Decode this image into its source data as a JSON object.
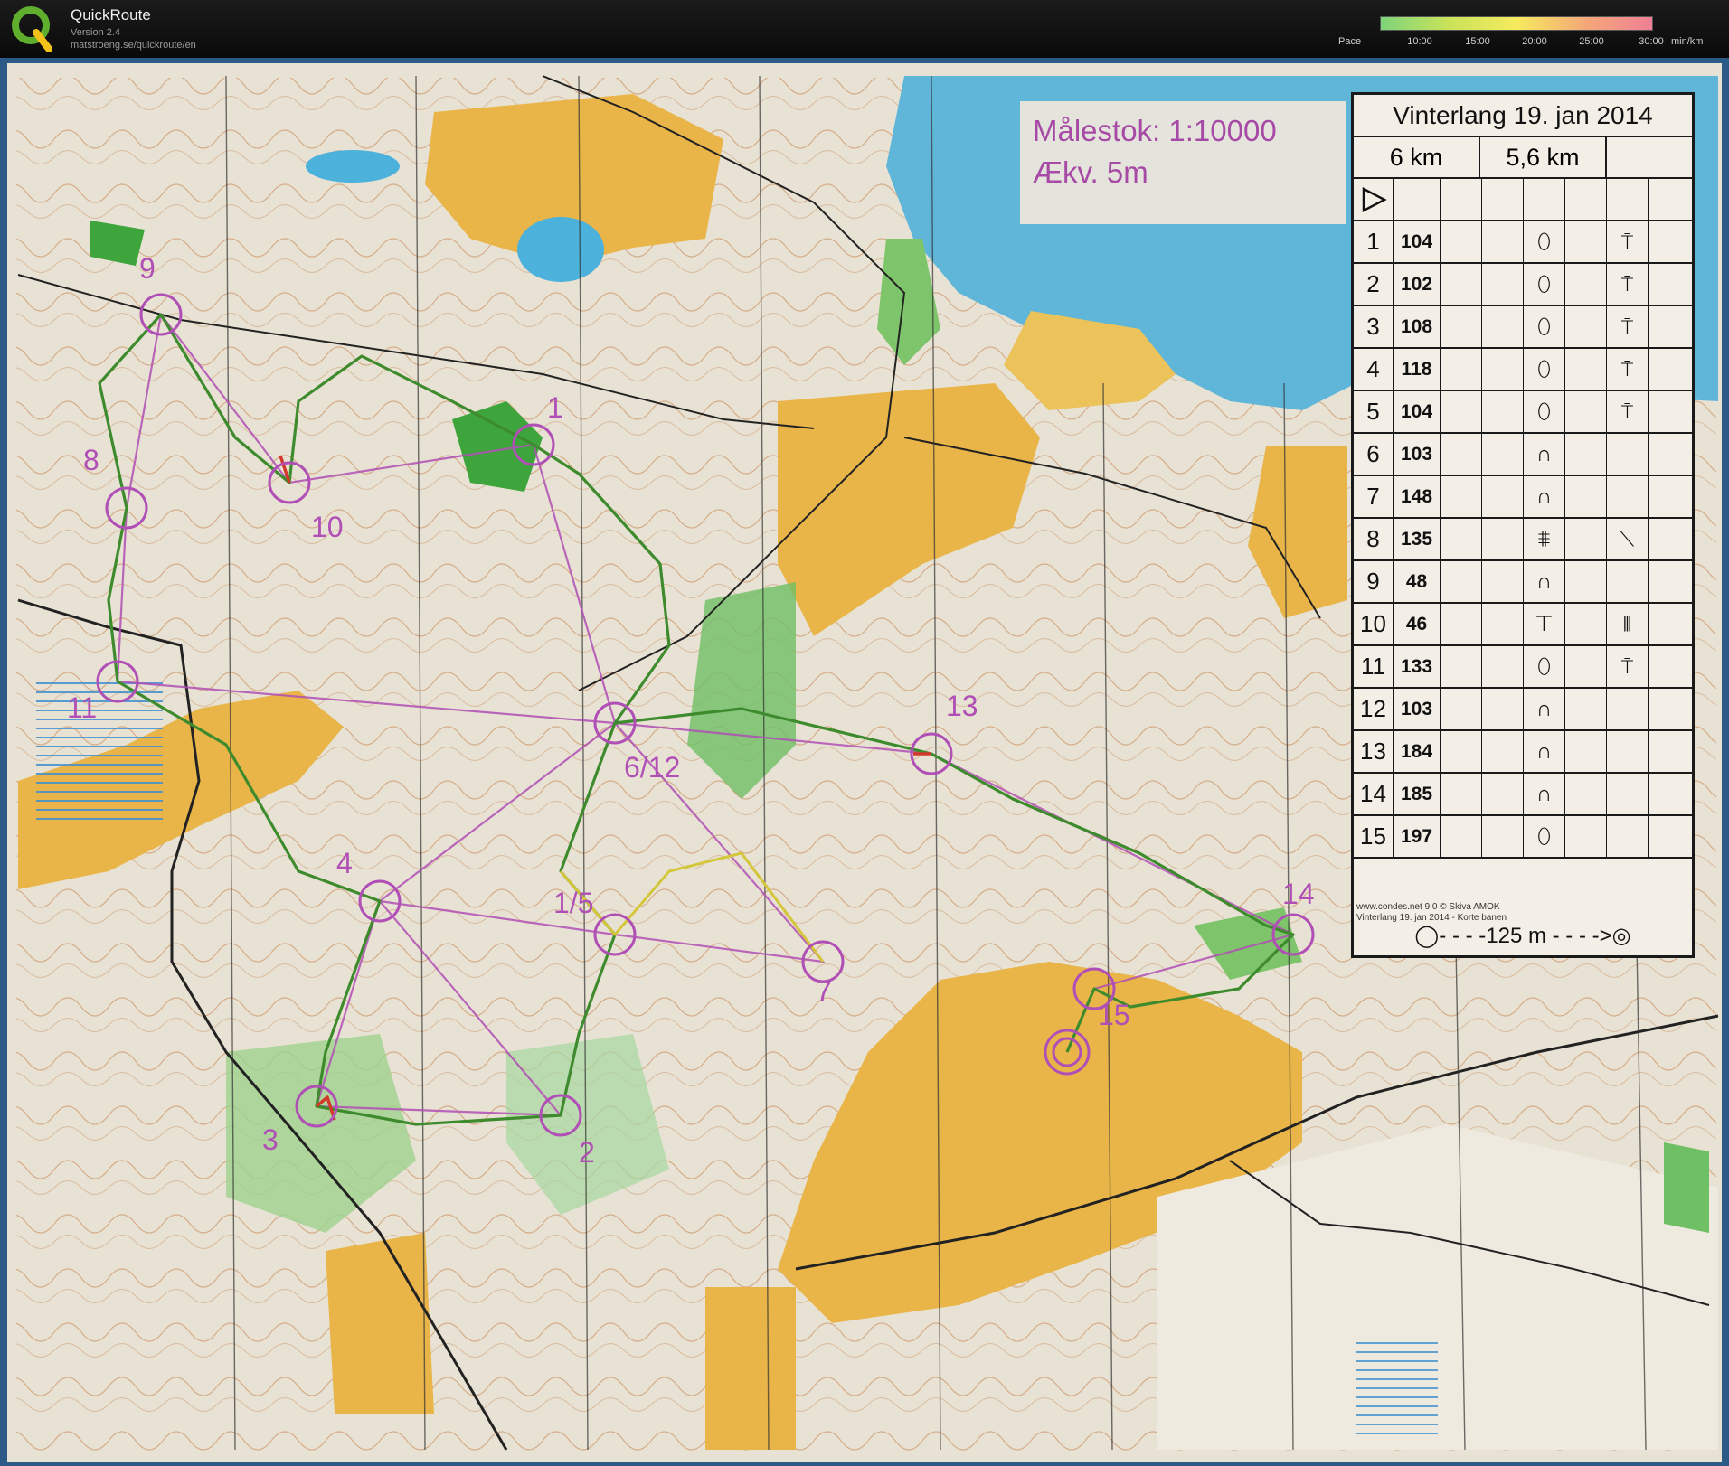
{
  "app": {
    "title": "QuickRoute",
    "version": "Version 2.4",
    "url": "matstroeng.se/quickroute/en"
  },
  "pace_scale": {
    "label": "Pace",
    "ticks": [
      "10:00",
      "15:00",
      "20:00",
      "25:00",
      "30:00"
    ],
    "unit": "min/km",
    "colors": [
      "#7ed37b",
      "#c9e35a",
      "#f6ea5e",
      "#f4a978",
      "#f07f96"
    ]
  },
  "map": {
    "scale_line1": "Målestok: 1:10000",
    "scale_line2": "Ækv. 5m",
    "credit_line1": "www.condes.net 9.0 © Skiva AMOK",
    "credit_line2": "Vinterlang 19. jan 2014 - Korte banen",
    "control_labels": [
      {
        "id": "c1",
        "text": "1"
      },
      {
        "id": "c2",
        "text": "2"
      },
      {
        "id": "c3",
        "text": "3"
      },
      {
        "id": "c4",
        "text": "4"
      },
      {
        "id": "c15a",
        "text": "1/5"
      },
      {
        "id": "c612",
        "text": "6/12"
      },
      {
        "id": "c7",
        "text": "7"
      },
      {
        "id": "c8",
        "text": "8"
      },
      {
        "id": "c9",
        "text": "9"
      },
      {
        "id": "c10",
        "text": "10"
      },
      {
        "id": "c11",
        "text": "11"
      },
      {
        "id": "c13",
        "text": "13"
      },
      {
        "id": "c14",
        "text": "14"
      },
      {
        "id": "c15",
        "text": "15"
      }
    ]
  },
  "course_card": {
    "title": "Vinterlang 19. jan 2014",
    "length_a": "6 km",
    "length_b": "5,6 km",
    "footer": "◯- - - -125 m - - - ->◎",
    "controls": [
      {
        "num": "1",
        "code": "104",
        "feature": "⬯",
        "detail": "⍑"
      },
      {
        "num": "2",
        "code": "102",
        "feature": "⬯",
        "detail": "⍑"
      },
      {
        "num": "3",
        "code": "108",
        "feature": "⬯",
        "detail": "⍑"
      },
      {
        "num": "4",
        "code": "118",
        "feature": "⬯",
        "detail": "⍑"
      },
      {
        "num": "5",
        "code": "104",
        "feature": "⬯",
        "detail": "⍑"
      },
      {
        "num": "6",
        "code": "103",
        "feature": "∩",
        "detail": ""
      },
      {
        "num": "7",
        "code": "148",
        "feature": "∩",
        "detail": ""
      },
      {
        "num": "8",
        "code": "135",
        "feature": "⩨",
        "detail": "⟍"
      },
      {
        "num": "9",
        "code": "48",
        "feature": "∩",
        "detail": ""
      },
      {
        "num": "10",
        "code": "46",
        "feature": "⊤",
        "detail": "⫴"
      },
      {
        "num": "11",
        "code": "133",
        "feature": "⬯",
        "detail": "⍑"
      },
      {
        "num": "12",
        "code": "103",
        "feature": "∩",
        "detail": ""
      },
      {
        "num": "13",
        "code": "184",
        "feature": "∩",
        "detail": ""
      },
      {
        "num": "14",
        "code": "185",
        "feature": "∩",
        "detail": ""
      },
      {
        "num": "15",
        "code": "197",
        "feature": "⬯",
        "detail": ""
      }
    ]
  }
}
